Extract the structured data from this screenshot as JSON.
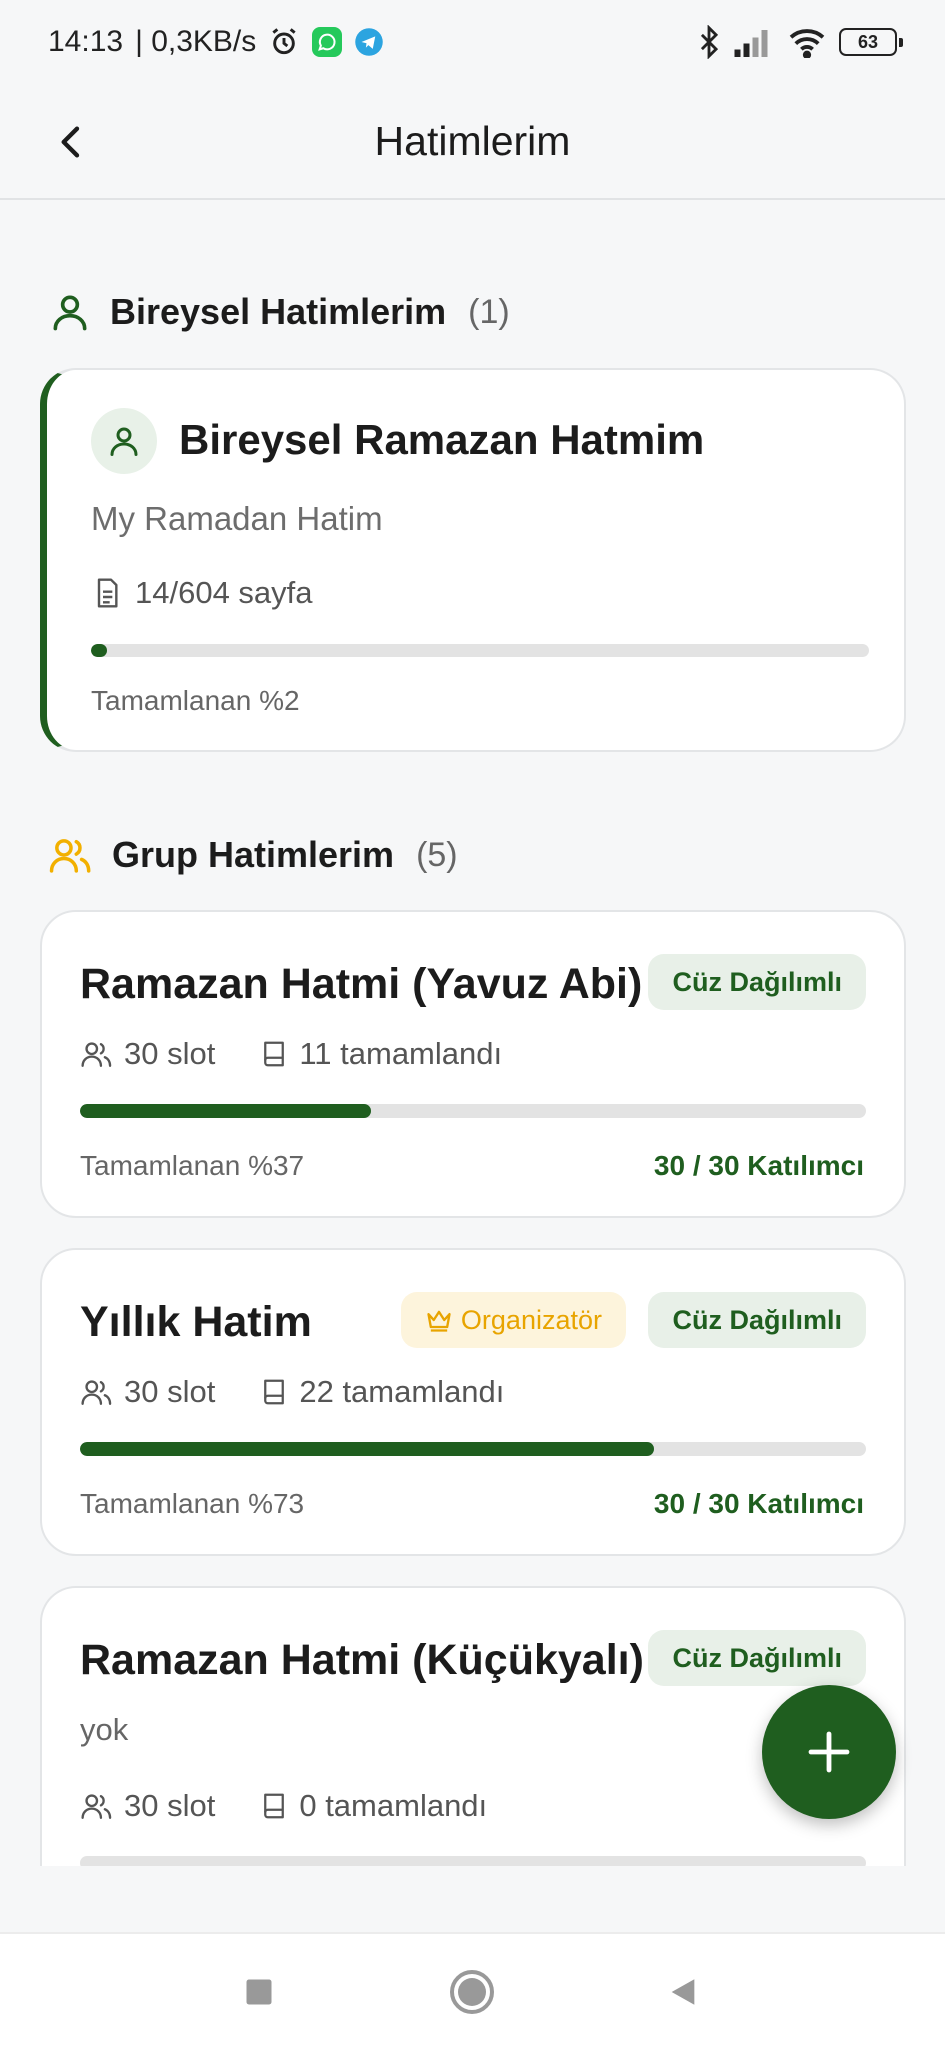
{
  "status_bar": {
    "time": "14:13",
    "speed": "| 0,3KB/s",
    "battery": "63",
    "icons": [
      "alarm-icon",
      "whatsapp-icon",
      "telegram-icon",
      "bluetooth-icon",
      "signal-icon",
      "wifi-icon",
      "battery-icon"
    ]
  },
  "header": {
    "title": "Hatimlerim"
  },
  "personal_section": {
    "title": "Bireysel Hatimlerim",
    "count": "(1)",
    "card": {
      "title": "Bireysel Ramazan Hatmim",
      "subtitle": "My Ramadan Hatim",
      "pages": "14/604 sayfa",
      "progress": 0.02,
      "complete_label": "Tamamlanan %2"
    }
  },
  "group_section": {
    "title": "Grup Hatimlerim",
    "count": "(5)",
    "cards": [
      {
        "title": "Ramazan Hatmi (Yavuz Abi)",
        "badge": "Cüz Dağılımlı",
        "slots": "30 slot",
        "completed": "11 tamamlandı",
        "progress": 0.37,
        "complete_label": "Tamamlanan %37",
        "participants": "30 / 30 Katılımcı"
      },
      {
        "title": "Yıllık Hatim",
        "organizer_badge": "Organizatör",
        "badge": "Cüz Dağılımlı",
        "slots": "30 slot",
        "completed": "22 tamamlandı",
        "progress": 0.73,
        "complete_label": "Tamamlanan %73",
        "participants": "30 / 30 Katılımcı"
      },
      {
        "title": "Ramazan Hatmi (Küçükyalı)",
        "badge": "Cüz Dağılımlı",
        "description": "yok",
        "slots": "30 slot",
        "completed": "0 tamamlandı",
        "progress": 0.0
      }
    ]
  },
  "colors": {
    "primary": "#1f5e1f",
    "organizer": "#e8a400",
    "background": "#f6f7f8"
  }
}
